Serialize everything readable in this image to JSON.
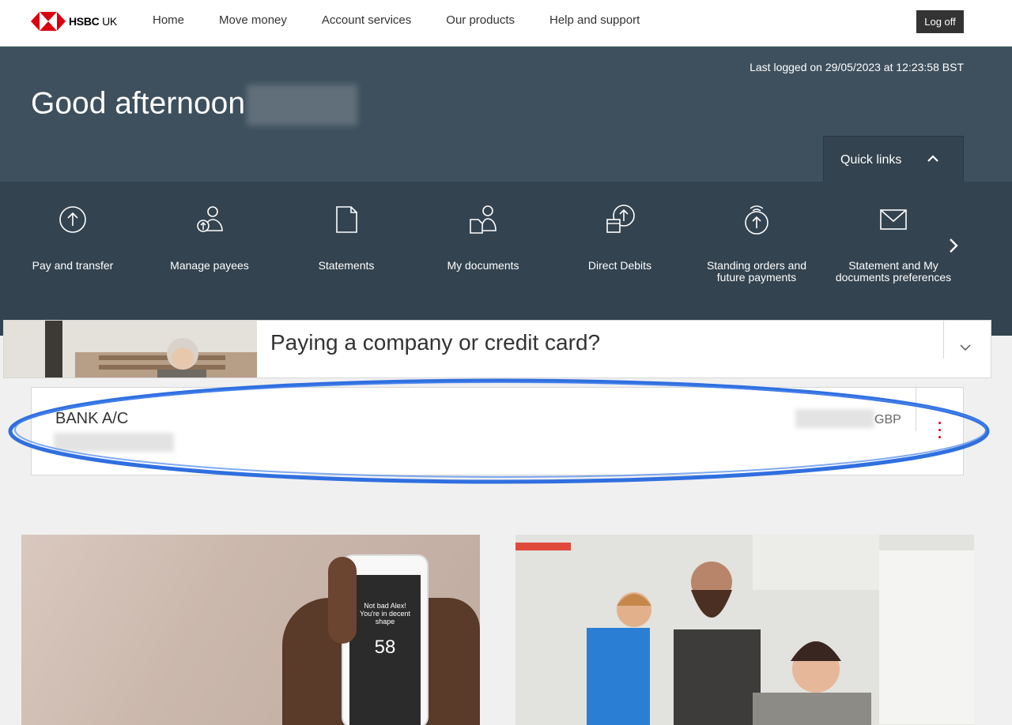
{
  "nav": {
    "logo_brand": "HSBC",
    "logo_suffix": "UK",
    "items": [
      {
        "label": "Home"
      },
      {
        "label": "Move money"
      },
      {
        "label": "Account services"
      },
      {
        "label": "Our products"
      },
      {
        "label": "Help and support"
      }
    ],
    "logoff_label": "Log off"
  },
  "hero": {
    "last_logged": "Last logged on 29/05/2023 at 12:23:58 BST",
    "greeting": "Good afternoon",
    "quick_links_label": "Quick links"
  },
  "quick_links": [
    {
      "label": "Pay and transfer",
      "icon": "pay-transfer-icon"
    },
    {
      "label": "Manage payees",
      "icon": "manage-payees-icon"
    },
    {
      "label": "Statements",
      "icon": "statements-icon"
    },
    {
      "label": "My documents",
      "icon": "my-documents-icon"
    },
    {
      "label": "Direct Debits",
      "icon": "direct-debits-icon"
    },
    {
      "label": "Standing orders and future payments",
      "icon": "standing-orders-icon"
    },
    {
      "label": "Statement and My documents preferences",
      "icon": "envelope-icon"
    }
  ],
  "banner": {
    "title": "Paying a company or credit card?"
  },
  "account": {
    "name": "BANK A/C",
    "currency": "GBP"
  },
  "promo_left": {
    "phone_lines": [
      "Not bad Alex!",
      "You're in decent shape"
    ],
    "score": "58"
  },
  "colors": {
    "brand_red": "#db0011",
    "hero_bg": "#3e505d",
    "quicklinks_bg": "#33434f",
    "highlight": "#2f6fe0"
  }
}
